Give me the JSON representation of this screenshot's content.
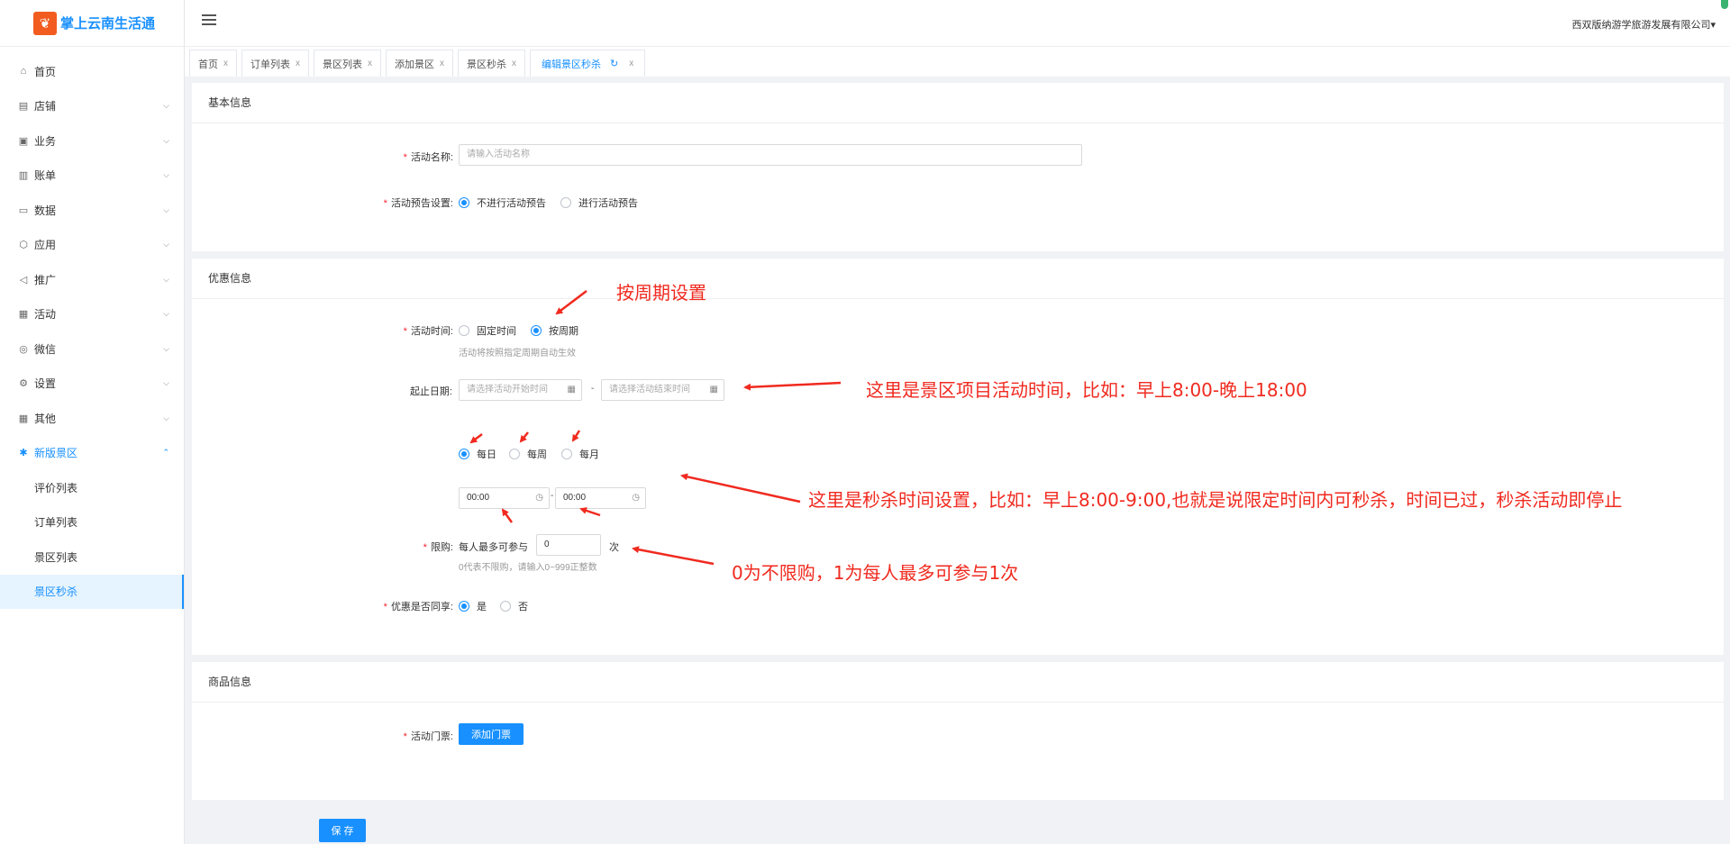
{
  "app": {
    "logo_glyph": "❦",
    "title": "掌上云南生活通",
    "company": "西双版纳游学旅游发展有限公司",
    "company_caret": "▾"
  },
  "sidebar": {
    "items": [
      {
        "label": "首页",
        "icon": "home-icon",
        "glyph": "⌂"
      },
      {
        "label": "店铺",
        "icon": "shop-icon",
        "glyph": "▤"
      },
      {
        "label": "业务",
        "icon": "briefcase-icon",
        "glyph": "▣"
      },
      {
        "label": "账单",
        "icon": "bill-icon",
        "glyph": "▥"
      },
      {
        "label": "数据",
        "icon": "monitor-icon",
        "glyph": "▭"
      },
      {
        "label": "应用",
        "icon": "cube-icon",
        "glyph": "⬡"
      },
      {
        "label": "推广",
        "icon": "megaphone-icon",
        "glyph": "◁"
      },
      {
        "label": "活动",
        "icon": "calendar-icon",
        "glyph": "▦"
      },
      {
        "label": "微信",
        "icon": "wechat-icon",
        "glyph": "◎"
      },
      {
        "label": "设置",
        "icon": "gear-icon",
        "glyph": "⚙"
      },
      {
        "label": "其他",
        "icon": "grid-icon",
        "glyph": "▦"
      },
      {
        "label": "新版景区",
        "icon": "scenic-icon",
        "glyph": "✱"
      }
    ],
    "arrow_down": "⌵",
    "arrow_up": "⌃",
    "sub_items": [
      "评价列表",
      "订单列表",
      "景区列表",
      "景区秒杀"
    ]
  },
  "tabs": [
    {
      "label": "首页"
    },
    {
      "label": "订单列表"
    },
    {
      "label": "景区列表"
    },
    {
      "label": "添加景区"
    },
    {
      "label": "景区秒杀"
    },
    {
      "label": "编辑景区秒杀"
    }
  ],
  "tab_close": "x",
  "tab_refresh": "↻",
  "basic": {
    "title": "基本信息",
    "name_label": "活动名称:",
    "name_placeholder": "请输入活动名称",
    "preview_label": "活动预告设置:",
    "preview_opt1": "不进行活动预告",
    "preview_opt2": "进行活动预告"
  },
  "discount": {
    "title": "优惠信息",
    "time_label": "活动时间:",
    "time_opt1": "固定时间",
    "time_opt2": "按周期",
    "time_hint": "活动将按照指定周期自动生效",
    "date_label": "起止日期:",
    "start_placeholder": "请选择活动开始时间",
    "end_placeholder": "请选择活动结束时间",
    "date_sep": "-",
    "period_daily": "每日",
    "period_weekly": "每周",
    "period_monthly": "每月",
    "time_start": "00:00",
    "time_end": "00:00",
    "limit_label": "限购:",
    "limit_prefix": "每人最多可参与",
    "limit_value": "0",
    "limit_suffix": "次",
    "limit_hint": "0代表不限购，请输入0~999正整数",
    "share_label": "优惠是否同享:",
    "share_yes": "是",
    "share_no": "否",
    "required": "*"
  },
  "goods": {
    "title": "商品信息",
    "ticket_label": "活动门票:",
    "add_ticket": "添加门票"
  },
  "save_label": "保 存",
  "annotations": {
    "cycle": "按周期设置",
    "date_range": "这里是景区项目活动时间，比如：早上8:00-晚上18:00",
    "seckill_time": "这里是秒杀时间设置，比如：早上8:00-9:00,也就是说限定时间内可秒杀，时间已过，秒杀活动即停止",
    "limit": "0为不限购，1为每人最多可参与1次"
  },
  "colors": {
    "primary": "#1890ff",
    "annotation": "#f02a1f",
    "logo": "#f25c1f",
    "required": "#f5222d"
  }
}
